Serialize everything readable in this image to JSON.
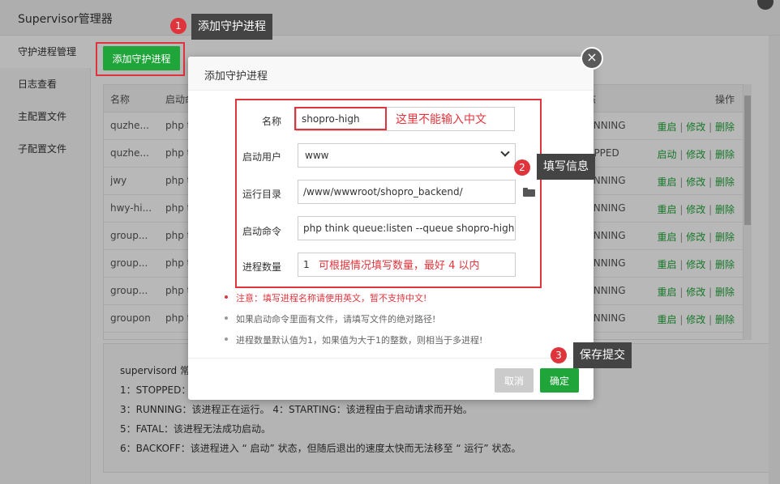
{
  "window": {
    "title": "Supervisor管理器"
  },
  "sidebar": {
    "items": [
      {
        "label": "守护进程管理"
      },
      {
        "label": "日志查看"
      },
      {
        "label": "主配置文件"
      },
      {
        "label": "子配置文件"
      }
    ]
  },
  "toolbar": {
    "add_label": "添加守护进程"
  },
  "table": {
    "headers": {
      "name": "名称",
      "cmd": "启动命",
      "status": "态",
      "ops": "操作"
    },
    "rows": [
      {
        "name": "quzhe...",
        "cmd": "php t",
        "status": "UNNING",
        "op1": "重启",
        "op2": "修改",
        "op3": "删除"
      },
      {
        "name": "quzhe...",
        "cmd": "php t",
        "status": "OPPED",
        "op1": "启动",
        "op2": "修改",
        "op3": "删除"
      },
      {
        "name": "jwy",
        "cmd": "php t",
        "status": "UNNING",
        "op1": "重启",
        "op2": "修改",
        "op3": "删除"
      },
      {
        "name": "hwy-hi...",
        "cmd": "php t",
        "status": "UNNING",
        "op1": "重启",
        "op2": "修改",
        "op3": "删除"
      },
      {
        "name": "group...",
        "cmd": "php t",
        "status": "UNNING",
        "op1": "重启",
        "op2": "修改",
        "op3": "删除"
      },
      {
        "name": "group...",
        "cmd": "php t",
        "status": "UNNING",
        "op1": "重启",
        "op2": "修改",
        "op3": "删除"
      },
      {
        "name": "group...",
        "cmd": "php t",
        "status": "UNNING",
        "op1": "重启",
        "op2": "修改",
        "op3": "删除"
      },
      {
        "name": "groupon",
        "cmd": "php t",
        "status": "UNNING",
        "op1": "重启",
        "op2": "修改",
        "op3": "删除"
      }
    ],
    "sep": "|"
  },
  "description": {
    "lines": [
      "supervisord 常",
      "1：STOPPED：",
      "3：RUNNING：该进程正在运行。 4：STARTING：该进程由于启动请求而开始。",
      "5：FATAL：该进程无法成功启动。",
      "6：BACKOFF：该进程进入 “ 启动” 状态，但随后退出的速度太快而无法移至 “ 运行” 状态。"
    ]
  },
  "modal": {
    "title": "添加守护进程",
    "close_symbol": "×",
    "fields": {
      "name_label": "名称",
      "name_value": "shopro-high",
      "user_label": "启动用户",
      "user_value": "www",
      "dir_label": "运行目录",
      "dir_value": "/www/wwwroot/shopro_backend/",
      "cmd_label": "启动命令",
      "cmd_value": "php think queue:listen --queue shopro-high",
      "count_label": "进程数量",
      "count_value": "1"
    },
    "tips": [
      "注意：填写进程名称请使用英文，暂不支持中文!",
      "如果启动命令里面有文件，请填写文件的绝对路径!",
      "进程数量默认值为1，如果值为大于1的整数，则相当于多进程!"
    ],
    "cancel_label": "取消",
    "ok_label": "确定"
  },
  "annotations": {
    "name_note": "这里不能输入中文",
    "count_note": "可根据情况填写数量，最好 4 以内",
    "step1_num": "1",
    "step1_text": "添加守护进程",
    "step2_num": "2",
    "step2_text": "填写信息",
    "step3_num": "3",
    "step3_text": "保存提交"
  },
  "colors": {
    "accent": "#20a53a",
    "annotation": "#e0343c",
    "callout_bg": "#444444"
  }
}
